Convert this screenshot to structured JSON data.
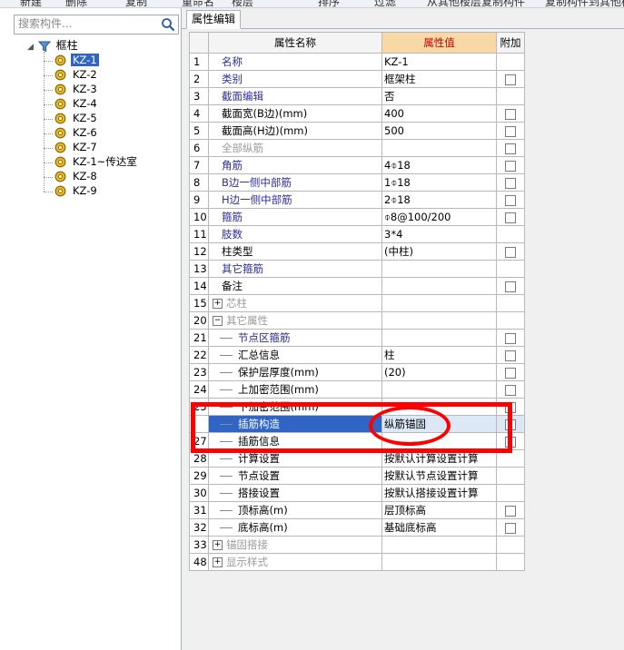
{
  "toolbar": {
    "items": [
      "新建",
      "删除",
      "复制",
      "重命名",
      "楼层",
      "排序",
      "过滤",
      "从其他楼层复制构件",
      "复制构件到其他楼层"
    ]
  },
  "search": {
    "placeholder": "搜索构件..."
  },
  "tree": {
    "root_label": "框柱",
    "items": [
      "KZ-1",
      "KZ-2",
      "KZ-3",
      "KZ-4",
      "KZ-5",
      "KZ-6",
      "KZ-7",
      "KZ-1~传达室",
      "KZ-8",
      "KZ-9"
    ],
    "selected_index": 0
  },
  "tab": {
    "label": "属性编辑"
  },
  "grid": {
    "headers": {
      "name": "属性名称",
      "value": "属性值",
      "extra": "附加"
    },
    "rows": [
      {
        "n": "1",
        "name": "名称",
        "value": "KZ-1",
        "color": "blue",
        "cb": false,
        "indent": 0
      },
      {
        "n": "2",
        "name": "类别",
        "value": "框架柱",
        "color": "blue",
        "cb": true,
        "indent": 0
      },
      {
        "n": "3",
        "name": "截面编辑",
        "value": "否",
        "color": "blue",
        "cb": false,
        "indent": 0
      },
      {
        "n": "4",
        "name": "截面宽(B边)(mm)",
        "value": "400",
        "color": "black",
        "cb": true,
        "indent": 0
      },
      {
        "n": "5",
        "name": "截面高(H边)(mm)",
        "value": "500",
        "color": "black",
        "cb": true,
        "indent": 0
      },
      {
        "n": "6",
        "name": "全部纵筋",
        "value": "",
        "color": "gray",
        "cb": true,
        "indent": 0
      },
      {
        "n": "7",
        "name": "角筋",
        "value": "4⌽18",
        "color": "blue",
        "cb": true,
        "indent": 0
      },
      {
        "n": "8",
        "name": "B边一侧中部筋",
        "value": "1⌽18",
        "color": "blue",
        "cb": true,
        "indent": 0
      },
      {
        "n": "9",
        "name": "H边一侧中部筋",
        "value": "2⌽18",
        "color": "blue",
        "cb": true,
        "indent": 0
      },
      {
        "n": "10",
        "name": "箍筋",
        "value": "⌽8@100/200",
        "color": "blue",
        "cb": true,
        "indent": 0
      },
      {
        "n": "11",
        "name": "肢数",
        "value": "3*4",
        "color": "blue",
        "cb": false,
        "indent": 0
      },
      {
        "n": "12",
        "name": "柱类型",
        "value": "(中柱)",
        "color": "black",
        "cb": true,
        "indent": 0
      },
      {
        "n": "13",
        "name": "其它箍筋",
        "value": "",
        "color": "blue",
        "cb": false,
        "indent": 0
      },
      {
        "n": "14",
        "name": "备注",
        "value": "",
        "color": "black",
        "cb": true,
        "indent": 0
      },
      {
        "n": "15",
        "name": "芯柱",
        "value": "",
        "color": "gray",
        "cb": false,
        "indent": 0,
        "expander": "+"
      },
      {
        "n": "20",
        "name": "其它属性",
        "value": "",
        "color": "gray",
        "cb": false,
        "indent": 0,
        "expander": "−"
      },
      {
        "n": "21",
        "name": "节点区箍筋",
        "value": "",
        "color": "blue",
        "cb": true,
        "indent": 1
      },
      {
        "n": "22",
        "name": "汇总信息",
        "value": "柱",
        "color": "black",
        "cb": true,
        "indent": 1
      },
      {
        "n": "23",
        "name": "保护层厚度(mm)",
        "value": "(20)",
        "color": "black",
        "cb": true,
        "indent": 1
      },
      {
        "n": "24",
        "name": "上加密范围(mm)",
        "value": "",
        "color": "black",
        "cb": true,
        "indent": 1
      },
      {
        "n": "25",
        "name": "下加密范围(mm)",
        "value": "",
        "color": "black",
        "cb": true,
        "indent": 1
      },
      {
        "n": "26",
        "name": "插筋构造",
        "value": "纵筋锚固",
        "color": "black",
        "cb": true,
        "indent": 1,
        "selected": true
      },
      {
        "n": "27",
        "name": "插筋信息",
        "value": "",
        "color": "black",
        "cb": true,
        "indent": 1
      },
      {
        "n": "28",
        "name": "计算设置",
        "value": "按默认计算设置计算",
        "color": "black",
        "cb": false,
        "indent": 1
      },
      {
        "n": "29",
        "name": "节点设置",
        "value": "按默认节点设置计算",
        "color": "black",
        "cb": false,
        "indent": 1
      },
      {
        "n": "30",
        "name": "搭接设置",
        "value": "按默认搭接设置计算",
        "color": "black",
        "cb": false,
        "indent": 1
      },
      {
        "n": "31",
        "name": "顶标高(m)",
        "value": "层顶标高",
        "color": "black",
        "cb": true,
        "indent": 1
      },
      {
        "n": "32",
        "name": "底标高(m)",
        "value": "基础底标高",
        "color": "black",
        "cb": true,
        "indent": 1
      },
      {
        "n": "33",
        "name": "锚固搭接",
        "value": "",
        "color": "gray",
        "cb": false,
        "indent": 0,
        "expander": "+"
      },
      {
        "n": "48",
        "name": "显示样式",
        "value": "",
        "color": "gray",
        "cb": false,
        "indent": 0,
        "expander": "+"
      }
    ]
  },
  "colors": {
    "selection": "#3165c5",
    "highlight": "#ff0000",
    "header_value_bg": "#f8d9a6"
  },
  "icons": {
    "search": "search-icon",
    "tree_root": "funnel-icon",
    "tree_item": "gear-icon"
  }
}
